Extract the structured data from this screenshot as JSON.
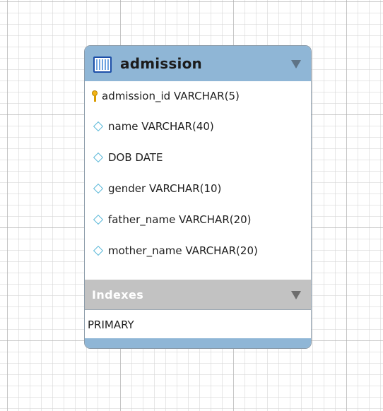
{
  "table": {
    "name": "admission",
    "icon": "table-icon",
    "header_color": "#8fb6d6",
    "columns": [
      {
        "label": "admission_id VARCHAR(5)",
        "icon": "key-icon"
      },
      {
        "label": "name VARCHAR(40)",
        "icon": "diamond-icon"
      },
      {
        "label": "DOB DATE",
        "icon": "diamond-icon"
      },
      {
        "label": "gender VARCHAR(10)",
        "icon": "diamond-icon"
      },
      {
        "label": "father_name VARCHAR(20)",
        "icon": "diamond-icon"
      },
      {
        "label": "mother_name VARCHAR(20)",
        "icon": "diamond-icon"
      }
    ],
    "indexes": {
      "title": "Indexes",
      "items": [
        "PRIMARY"
      ]
    }
  }
}
